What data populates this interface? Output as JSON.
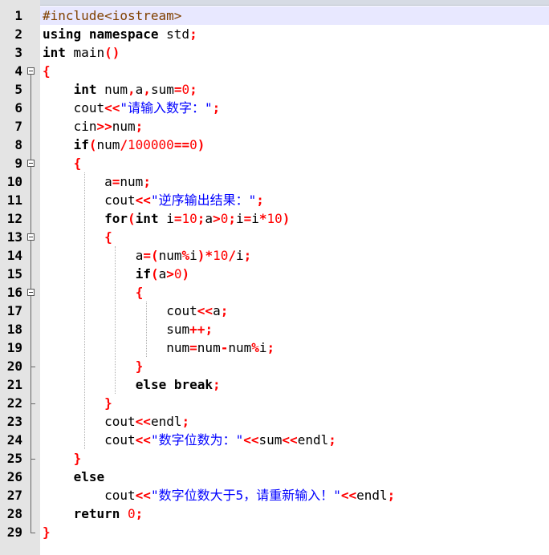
{
  "lines": [
    {
      "n": "1",
      "code": "#include<iostream>"
    },
    {
      "n": "2",
      "code": "using namespace std;"
    },
    {
      "n": "3",
      "code": "int main()"
    },
    {
      "n": "4",
      "code": "{"
    },
    {
      "n": "5",
      "code": "    int num,a,sum=0;"
    },
    {
      "n": "6",
      "code": "    cout<<\"请输入数字：\";"
    },
    {
      "n": "7",
      "code": "    cin>>num;"
    },
    {
      "n": "8",
      "code": "    if(num/100000==0)"
    },
    {
      "n": "9",
      "code": "    {"
    },
    {
      "n": "10",
      "code": "        a=num;"
    },
    {
      "n": "11",
      "code": "        cout<<\"逆序输出结果：\";"
    },
    {
      "n": "12",
      "code": "        for(int i=10;a>0;i=i*10)"
    },
    {
      "n": "13",
      "code": "        {"
    },
    {
      "n": "14",
      "code": "            a=(num%i)*10/i;"
    },
    {
      "n": "15",
      "code": "            if(a>0)"
    },
    {
      "n": "16",
      "code": "            {"
    },
    {
      "n": "17",
      "code": "                cout<<a;"
    },
    {
      "n": "18",
      "code": "                sum++;"
    },
    {
      "n": "19",
      "code": "                num=num-num%i;"
    },
    {
      "n": "20",
      "code": "            }"
    },
    {
      "n": "21",
      "code": "            else break;"
    },
    {
      "n": "22",
      "code": "        }"
    },
    {
      "n": "23",
      "code": "        cout<<endl;"
    },
    {
      "n": "24",
      "code": "        cout<<\"数字位数为：\"<<sum<<endl;"
    },
    {
      "n": "25",
      "code": "    }"
    },
    {
      "n": "26",
      "code": "    else"
    },
    {
      "n": "27",
      "code": "        cout<<\"数字位数大于5，请重新输入！\"<<endl;"
    },
    {
      "n": "28",
      "code": "    return 0;"
    },
    {
      "n": "29",
      "code": "}"
    }
  ],
  "colors": {
    "gutter": "#e4e4e4",
    "current_line": "#e8e8ff",
    "keyword": "#000080",
    "operator": "#ff0000",
    "string": "#0000ff",
    "number": "#ff0000",
    "preprocessor": "#804000"
  },
  "icons": {
    "fold": "minus-box-icon"
  }
}
